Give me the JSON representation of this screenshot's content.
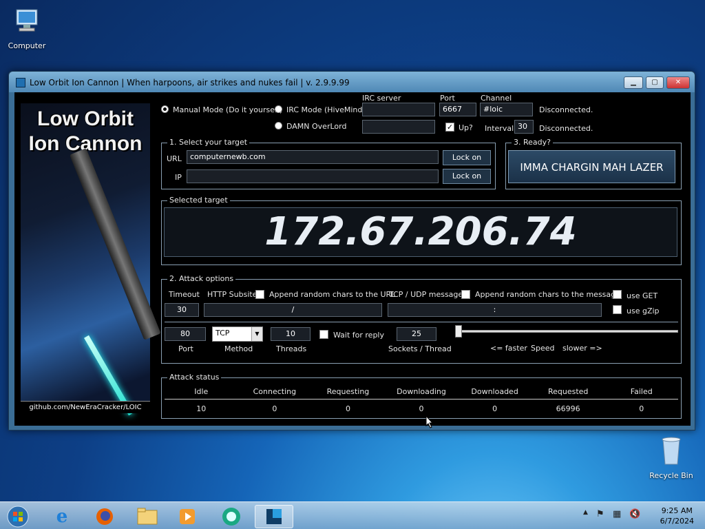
{
  "desktop": {
    "computer_label": "Computer",
    "recycle_label": "Recycle Bin"
  },
  "window": {
    "title": "Low Orbit Ion Cannon | When harpoons, air strikes and nukes fail | v. 2.9.9.99"
  },
  "banner": {
    "line1": "Low Orbit",
    "line2": "Ion Cannon",
    "github": "github.com/NewEraCracker/LOIC"
  },
  "mode": {
    "manual": "Manual Mode (Do it yourself)",
    "irc": "IRC Mode (HiveMind)",
    "overlord": "DAMN OverLord"
  },
  "irc": {
    "server_label": "IRC server",
    "server_value": "",
    "port_label": "Port",
    "port_value": "6667",
    "channel_label": "Channel",
    "channel_value": "#loic",
    "status1": "Disconnected.",
    "up_label": "Up?",
    "interval_label": "Interval:",
    "interval_value": "30",
    "status2": "Disconnected."
  },
  "target": {
    "group_label": "1. Select your target",
    "url_label": "URL",
    "url_value": "computernewb.com",
    "ip_label": "IP",
    "ip_value": "",
    "lock_url": "Lock on",
    "lock_ip": "Lock on"
  },
  "ready": {
    "group_label": "3. Ready?",
    "button": "IMMA CHARGIN MAH LAZER"
  },
  "selected": {
    "group_label": "Selected target",
    "ip": "172.67.206.74"
  },
  "attack": {
    "group_label": "2. Attack options",
    "timeout_label": "Timeout",
    "timeout_value": "30",
    "http_label": "HTTP Subsite",
    "http_value": "/",
    "append_url": "Append random chars to the URL",
    "tcp_label": "TCP / UDP message",
    "tcp_value": ":",
    "append_msg": "Append random chars to the message",
    "use_get": "use GET",
    "use_gzip": "use gZip",
    "port_value": "80",
    "port_label": "Port",
    "method_value": "TCP",
    "method_label": "Method",
    "threads_value": "10",
    "threads_label": "Threads",
    "wait_label": "Wait for reply",
    "sockets_value": "25",
    "sockets_label": "Sockets / Thread",
    "faster": "<= faster",
    "speed": "Speed",
    "slower": "slower =>",
    "speed_level": 0
  },
  "status": {
    "group_label": "Attack status",
    "headers": [
      "Idle",
      "Connecting",
      "Requesting",
      "Downloading",
      "Downloaded",
      "Requested",
      "Failed"
    ],
    "values": [
      "10",
      "0",
      "0",
      "0",
      "0",
      "66996",
      "0"
    ]
  },
  "taskbar": {
    "time": "9:25 AM",
    "date": "6/7/2024"
  }
}
